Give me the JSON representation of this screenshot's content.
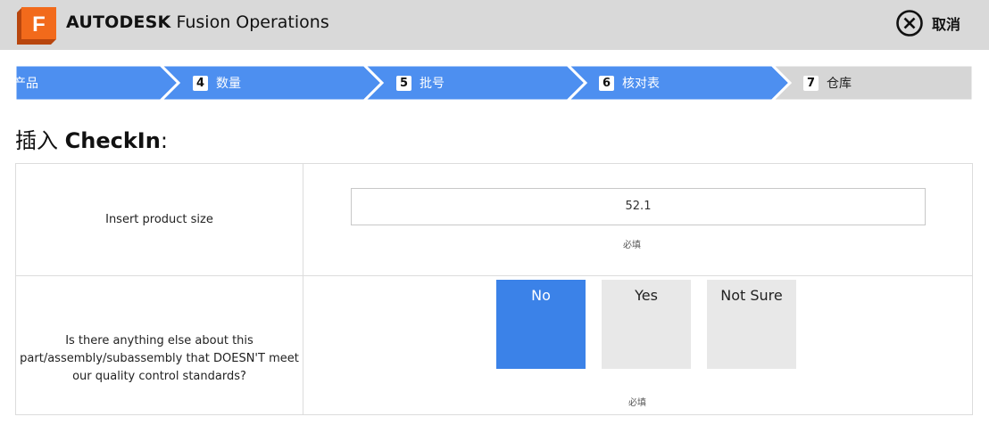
{
  "header": {
    "brand_bold": "AUTODESK",
    "brand_rest": " Fusion Operations",
    "logo_letter": "F",
    "cancel_label": "取消"
  },
  "steps": [
    {
      "number": "",
      "label": "产品",
      "state": "completed"
    },
    {
      "number": "4",
      "label": "数量",
      "state": "completed"
    },
    {
      "number": "5",
      "label": "批号",
      "state": "completed"
    },
    {
      "number": "6",
      "label": "核对表",
      "state": "current"
    },
    {
      "number": "7",
      "label": "仓库",
      "state": "upcoming"
    }
  ],
  "page_title": {
    "prefix": "插入 ",
    "bold": "CheckIn",
    "suffix": ":"
  },
  "form": {
    "product_size": {
      "label": "Insert product size",
      "value": "52.1",
      "required_text": "必填"
    },
    "quality_question": {
      "label": "Is there anything else about this part/assembly/subassembly that DOESN'T meet our quality control standards?",
      "options": [
        "No",
        "Yes",
        "Not Sure"
      ],
      "selected": "No",
      "required_text": "必填"
    }
  },
  "colors": {
    "step_active": "#4d8ff0",
    "step_upcoming": "#d6d6d6",
    "selected_option": "#3b82e8",
    "unselected_option": "#e8e8e8",
    "header_bg": "#d9d9d9",
    "logo_orange": "#f26a1b"
  }
}
